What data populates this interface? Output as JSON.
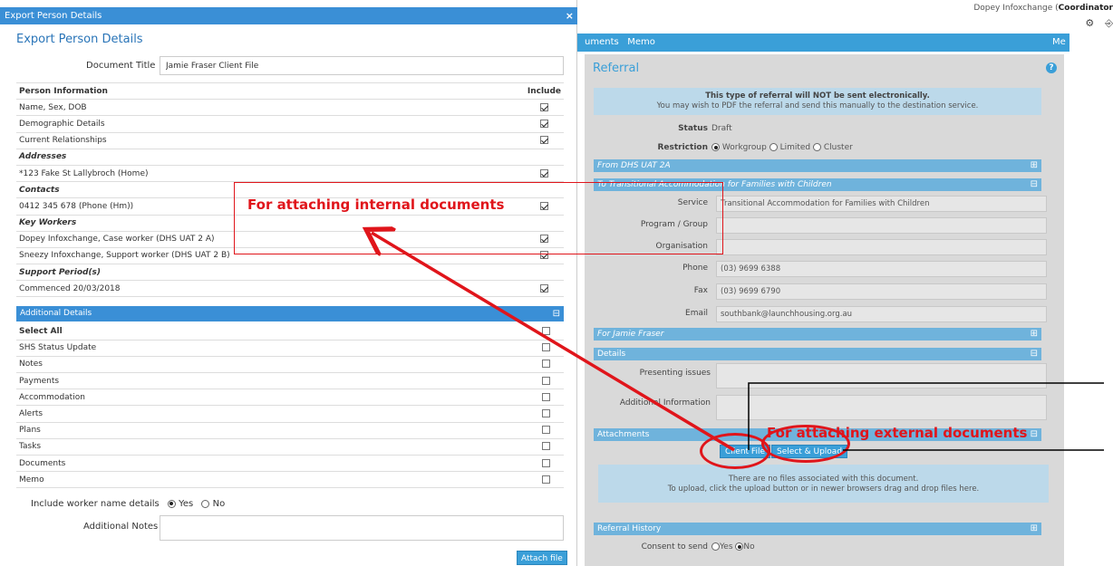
{
  "app": {
    "user_prefix": "Dopey Infoxchange (",
    "user_role": "Coordinator",
    "nav_left": "uments",
    "nav_memo": "Memo",
    "nav_right": "Me",
    "panel_title": "Referral",
    "notice_line1": "This type of referral will NOT be sent electronically.",
    "notice_line2": "You may wish to PDF the referral and send this manually to the destination service.",
    "status_label": "Status",
    "status_value": "Draft",
    "restriction_label": "Restriction",
    "restriction_options": [
      "Workgroup",
      "Limited",
      "Cluster"
    ],
    "from_bar": "From DHS UAT 2A",
    "to_bar": "To Transitional Accommodation for Families with Children",
    "service_label": "Service",
    "service_value": "Transitional Accommodation for Families with Children",
    "program_label": "Program / Group",
    "organisation_label": "Organisation",
    "phone_label": "Phone",
    "phone_value": "(03) 9699 6388",
    "fax_label": "Fax",
    "fax_value": "(03) 9699 6790",
    "email_label": "Email",
    "email_value": "southbank@launchhousing.org.au",
    "for_bar": "For Jamie Fraser",
    "details_bar": "Details",
    "presenting_label": "Presenting issues",
    "additional_info_label": "Additional Information",
    "attachments_bar": "Attachments",
    "client_file_btn": "Client File",
    "select_upload_btn": "Select & Upload",
    "dropzone_line1": "There are no files associated with this document.",
    "dropzone_line2": "To upload, click the upload button or in newer browsers drag and drop files here.",
    "history_bar": "Referral History",
    "consent_label": "Consent to send",
    "consent_options": [
      "Yes",
      "No"
    ]
  },
  "modal": {
    "titlebar": "Export Person Details",
    "close": "×",
    "heading": "Export Person Details",
    "doc_title_label": "Document Title",
    "doc_title_value": "Jamie Fraser Client File",
    "person_header": "Person Information",
    "include_header": "Include",
    "person_rows": [
      {
        "label": "Name, Sex, DOB",
        "type": "item",
        "checked": true
      },
      {
        "label": "Demographic Details",
        "type": "item",
        "checked": true
      },
      {
        "label": "Current Relationships",
        "type": "item",
        "checked": true
      },
      {
        "label": "Addresses",
        "type": "group"
      },
      {
        "label": "*123 Fake St Lallybroch (Home)",
        "type": "item",
        "checked": true
      },
      {
        "label": "Contacts",
        "type": "group"
      },
      {
        "label": "0412 345 678 (Phone (Hm))",
        "type": "item",
        "checked": true
      },
      {
        "label": "Key Workers",
        "type": "group"
      },
      {
        "label": "Dopey Infoxchange, Case worker (DHS UAT 2 A)",
        "type": "item",
        "checked": true
      },
      {
        "label": "Sneezy Infoxchange, Support worker (DHS UAT 2 B)",
        "type": "item",
        "checked": true
      },
      {
        "label": "Support Period(s)",
        "type": "group"
      },
      {
        "label": "Commenced 20/03/2018",
        "type": "item",
        "checked": true
      }
    ],
    "additional_header": "Additional Details",
    "additional_rows": [
      {
        "label": "Select All",
        "bold": true,
        "checked": false
      },
      {
        "label": "SHS Status Update",
        "checked": false
      },
      {
        "label": "Notes",
        "checked": false
      },
      {
        "label": "Payments",
        "checked": false
      },
      {
        "label": "Accommodation",
        "checked": false
      },
      {
        "label": "Alerts",
        "checked": false
      },
      {
        "label": "Plans",
        "checked": false
      },
      {
        "label": "Tasks",
        "checked": false
      },
      {
        "label": "Documents",
        "checked": false
      },
      {
        "label": "Memo",
        "checked": false
      }
    ],
    "include_worker_label": "Include worker name details",
    "include_worker_yes": "Yes",
    "include_worker_no": "No",
    "notes_label": "Additional Notes",
    "attach_btn": "Attach file"
  },
  "annotations": {
    "internal": "For attaching internal documents",
    "external": "For attaching external documents",
    "color": "#e0151b"
  }
}
